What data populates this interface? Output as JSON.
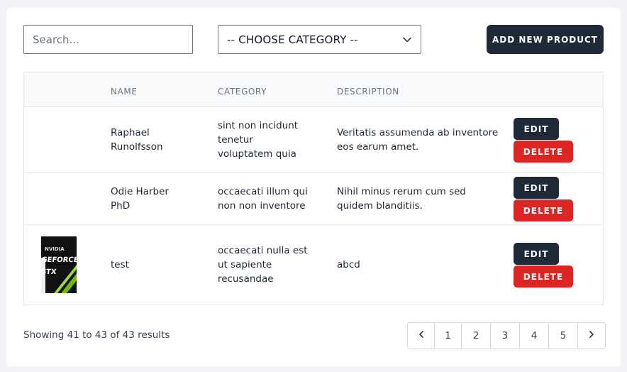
{
  "search": {
    "placeholder": "Search...",
    "value": ""
  },
  "category_select": {
    "selected": "-- CHOOSE CATEGORY --"
  },
  "add_button": {
    "label": "ADD NEW PRODUCT"
  },
  "table": {
    "headers": [
      "",
      "NAME",
      "CATEGORY",
      "DESCRIPTION",
      ""
    ],
    "rows": [
      {
        "name": "Raphael Runolfsson",
        "category": "sint non incidunt tenetur voluptatem quia",
        "description": "Veritatis assumenda ab inventore eos earum amet.",
        "has_image": false
      },
      {
        "name": "Odie Harber PhD",
        "category": "occaecati illum qui non non inventore",
        "description": "Nihil minus rerum cum sed quidem blanditiis.",
        "has_image": true
      },
      {
        "name": "test",
        "category": "occaecati nulla est ut sapiente recusandae",
        "description": "abcd",
        "has_image": true,
        "image_text": [
          "NVIDIA",
          "GEFORCE",
          "GTX"
        ]
      }
    ],
    "edit_label": "EDIT",
    "delete_label": "DELETE"
  },
  "status_text": "Showing 41 to 43 of 43 results",
  "pagination": {
    "prev_icon": "chevron-left-icon",
    "pages": [
      "1",
      "2",
      "3",
      "4",
      "5"
    ],
    "next_icon": "chevron-right-icon"
  },
  "colors": {
    "primary": "#1f2937",
    "danger": "#dc2626",
    "header_bg": "#f8f9fa",
    "page_bg": "#f1f3f6"
  }
}
